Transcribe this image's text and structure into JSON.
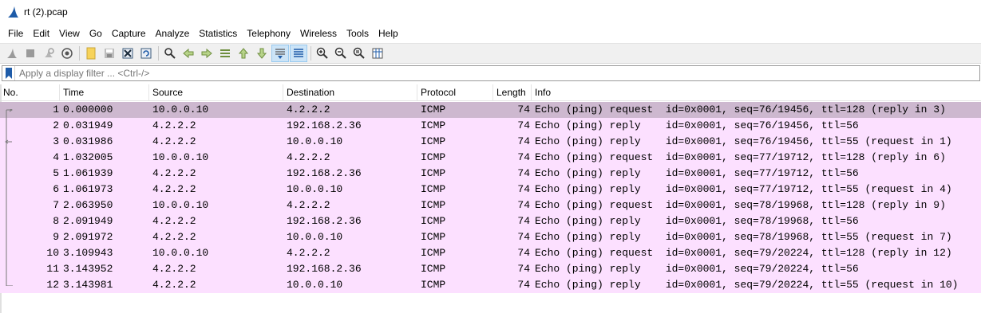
{
  "window": {
    "title": "rt (2).pcap"
  },
  "menu": [
    "File",
    "Edit",
    "View",
    "Go",
    "Capture",
    "Analyze",
    "Statistics",
    "Telephony",
    "Wireless",
    "Tools",
    "Help"
  ],
  "filter": {
    "placeholder": "Apply a display filter ... <Ctrl-/>"
  },
  "columns": {
    "no": "No.",
    "time": "Time",
    "source": "Source",
    "destination": "Destination",
    "protocol": "Protocol",
    "length": "Length",
    "info": "Info"
  },
  "packets": [
    {
      "no": "1",
      "time": "0.000000",
      "source": "10.0.0.10",
      "destination": "4.2.2.2",
      "protocol": "ICMP",
      "length": "74",
      "info": "Echo (ping) request  id=0x0001, seq=76/19456, ttl=128 (reply in 3)"
    },
    {
      "no": "2",
      "time": "0.031949",
      "source": "4.2.2.2",
      "destination": "192.168.2.36",
      "protocol": "ICMP",
      "length": "74",
      "info": "Echo (ping) reply    id=0x0001, seq=76/19456, ttl=56"
    },
    {
      "no": "3",
      "time": "0.031986",
      "source": "4.2.2.2",
      "destination": "10.0.0.10",
      "protocol": "ICMP",
      "length": "74",
      "info": "Echo (ping) reply    id=0x0001, seq=76/19456, ttl=55 (request in 1)"
    },
    {
      "no": "4",
      "time": "1.032005",
      "source": "10.0.0.10",
      "destination": "4.2.2.2",
      "protocol": "ICMP",
      "length": "74",
      "info": "Echo (ping) request  id=0x0001, seq=77/19712, ttl=128 (reply in 6)"
    },
    {
      "no": "5",
      "time": "1.061939",
      "source": "4.2.2.2",
      "destination": "192.168.2.36",
      "protocol": "ICMP",
      "length": "74",
      "info": "Echo (ping) reply    id=0x0001, seq=77/19712, ttl=56"
    },
    {
      "no": "6",
      "time": "1.061973",
      "source": "4.2.2.2",
      "destination": "10.0.0.10",
      "protocol": "ICMP",
      "length": "74",
      "info": "Echo (ping) reply    id=0x0001, seq=77/19712, ttl=55 (request in 4)"
    },
    {
      "no": "7",
      "time": "2.063950",
      "source": "10.0.0.10",
      "destination": "4.2.2.2",
      "protocol": "ICMP",
      "length": "74",
      "info": "Echo (ping) request  id=0x0001, seq=78/19968, ttl=128 (reply in 9)"
    },
    {
      "no": "8",
      "time": "2.091949",
      "source": "4.2.2.2",
      "destination": "192.168.2.36",
      "protocol": "ICMP",
      "length": "74",
      "info": "Echo (ping) reply    id=0x0001, seq=78/19968, ttl=56"
    },
    {
      "no": "9",
      "time": "2.091972",
      "source": "4.2.2.2",
      "destination": "10.0.0.10",
      "protocol": "ICMP",
      "length": "74",
      "info": "Echo (ping) reply    id=0x0001, seq=78/19968, ttl=55 (request in 7)"
    },
    {
      "no": "10",
      "time": "3.109943",
      "source": "10.0.0.10",
      "destination": "4.2.2.2",
      "protocol": "ICMP",
      "length": "74",
      "info": "Echo (ping) request  id=0x0001, seq=79/20224, ttl=128 (reply in 12)"
    },
    {
      "no": "11",
      "time": "3.143952",
      "source": "4.2.2.2",
      "destination": "192.168.2.36",
      "protocol": "ICMP",
      "length": "74",
      "info": "Echo (ping) reply    id=0x0001, seq=79/20224, ttl=56"
    },
    {
      "no": "12",
      "time": "3.143981",
      "source": "4.2.2.2",
      "destination": "10.0.0.10",
      "protocol": "ICMP",
      "length": "74",
      "info": "Echo (ping) reply    id=0x0001, seq=79/20224, ttl=55 (request in 10)"
    }
  ],
  "colors": {
    "row_icmp": "#fce0ff",
    "row_selected": "#cdb8cf",
    "toolbar_bg": "#f0f0f0",
    "accent": "#1e5ba8"
  },
  "toolbar_icons": [
    "shark-fin-start-icon",
    "stop-icon",
    "restart-icon",
    "capture-options-icon",
    "open-file-icon",
    "save-file-icon",
    "close-file-icon",
    "reload-file-icon",
    "find-packet-icon",
    "go-back-icon",
    "go-forward-icon",
    "go-to-packet-icon",
    "go-first-icon",
    "go-last-icon",
    "autoscroll-icon",
    "colorize-icon",
    "zoom-in-icon",
    "zoom-out-icon",
    "zoom-normal-icon",
    "resize-columns-icon"
  ]
}
